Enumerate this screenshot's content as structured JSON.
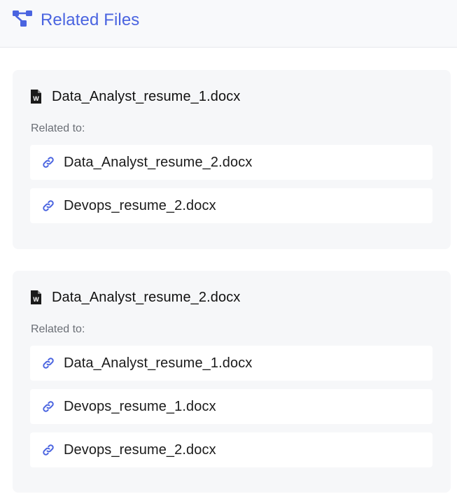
{
  "header": {
    "title": "Related Files",
    "icon": "relationship-icon",
    "accent_color": "#4a64e0"
  },
  "cards": [
    {
      "file_name": "Data_Analyst_resume_1.docx",
      "file_icon": "word-document-icon",
      "related_label": "Related to:",
      "related": [
        {
          "name": "Data_Analyst_resume_2.docx",
          "icon": "link-icon"
        },
        {
          "name": "Devops_resume_2.docx",
          "icon": "link-icon"
        }
      ]
    },
    {
      "file_name": "Data_Analyst_resume_2.docx",
      "file_icon": "word-document-icon",
      "related_label": "Related to:",
      "related": [
        {
          "name": "Data_Analyst_resume_1.docx",
          "icon": "link-icon"
        },
        {
          "name": "Devops_resume_1.docx",
          "icon": "link-icon"
        },
        {
          "name": "Devops_resume_2.docx",
          "icon": "link-icon"
        }
      ]
    }
  ]
}
